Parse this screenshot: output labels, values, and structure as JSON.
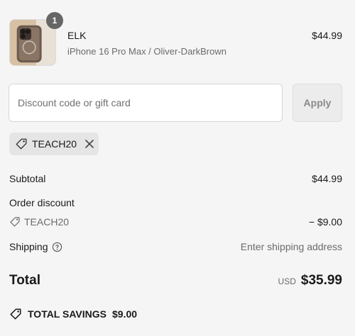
{
  "product": {
    "quantity": "1",
    "name": "ELK",
    "variant": "iPhone 16 Pro Max / Oliver-DarkBrown",
    "price": "$44.99"
  },
  "discount": {
    "placeholder": "Discount code or gift card",
    "apply_label": "Apply",
    "applied_code": "TEACH20"
  },
  "summary": {
    "subtotal_label": "Subtotal",
    "subtotal_value": "$44.99",
    "order_discount_label": "Order discount",
    "discount_code": "TEACH20",
    "discount_value": "− $9.00",
    "shipping_label": "Shipping",
    "shipping_value": "Enter shipping address",
    "total_label": "Total",
    "currency": "USD",
    "total_value": "$35.99",
    "savings_label": "TOTAL SAVINGS",
    "savings_value": "$9.00"
  },
  "icons": {
    "tag": "tag-icon",
    "close": "close-icon",
    "help": "help-circle-icon",
    "product_image": "phone-case-image"
  }
}
